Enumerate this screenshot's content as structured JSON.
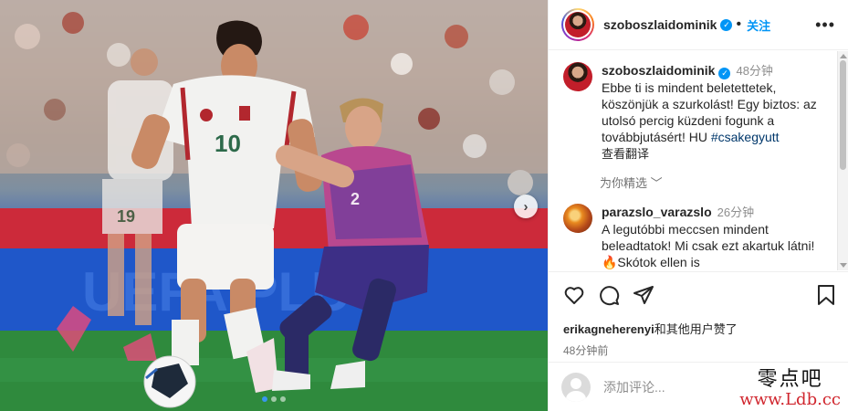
{
  "photo": {
    "players": [
      {
        "jersey_number": "10"
      },
      {
        "jersey_number": "19"
      },
      {
        "jersey_number": "2"
      }
    ],
    "carousel": {
      "dots": 3,
      "active_index": 0
    }
  },
  "header": {
    "username": "szoboszlaidominik",
    "separator": "•",
    "follow_label": "关注",
    "more_label": "•••"
  },
  "caption": {
    "username": "szoboszlaidominik",
    "time": "48分钟",
    "text": "Ebbe ti is mindent beletettetek, köszönjük a szurkolást! Egy biztos: az utolsó percig küzdeni fogunk a továbbjutásért! HU ",
    "hashtag": "#csakegyutt",
    "translate": "查看翻译"
  },
  "selected_label": "为你精选",
  "comment": {
    "username": "parazslo_varazslo",
    "time": "26分钟",
    "text": "A legutóbbi meccsen mindent beleadtatok! Mi csak ezt akartuk látni!🔥Skótok ellen is"
  },
  "likes": {
    "user": "erikagneherenyi",
    "suffix": "和其他用户赞了"
  },
  "posted": "48分钟前",
  "add_comment": {
    "placeholder": "添加评论..."
  },
  "watermark": {
    "text": "零点吧",
    "url": "www.Ldb.cc"
  },
  "colors": {
    "accent": "#0095f6",
    "hungary_kit": "#f2f2f0",
    "germany_kit": "#b9488f"
  }
}
